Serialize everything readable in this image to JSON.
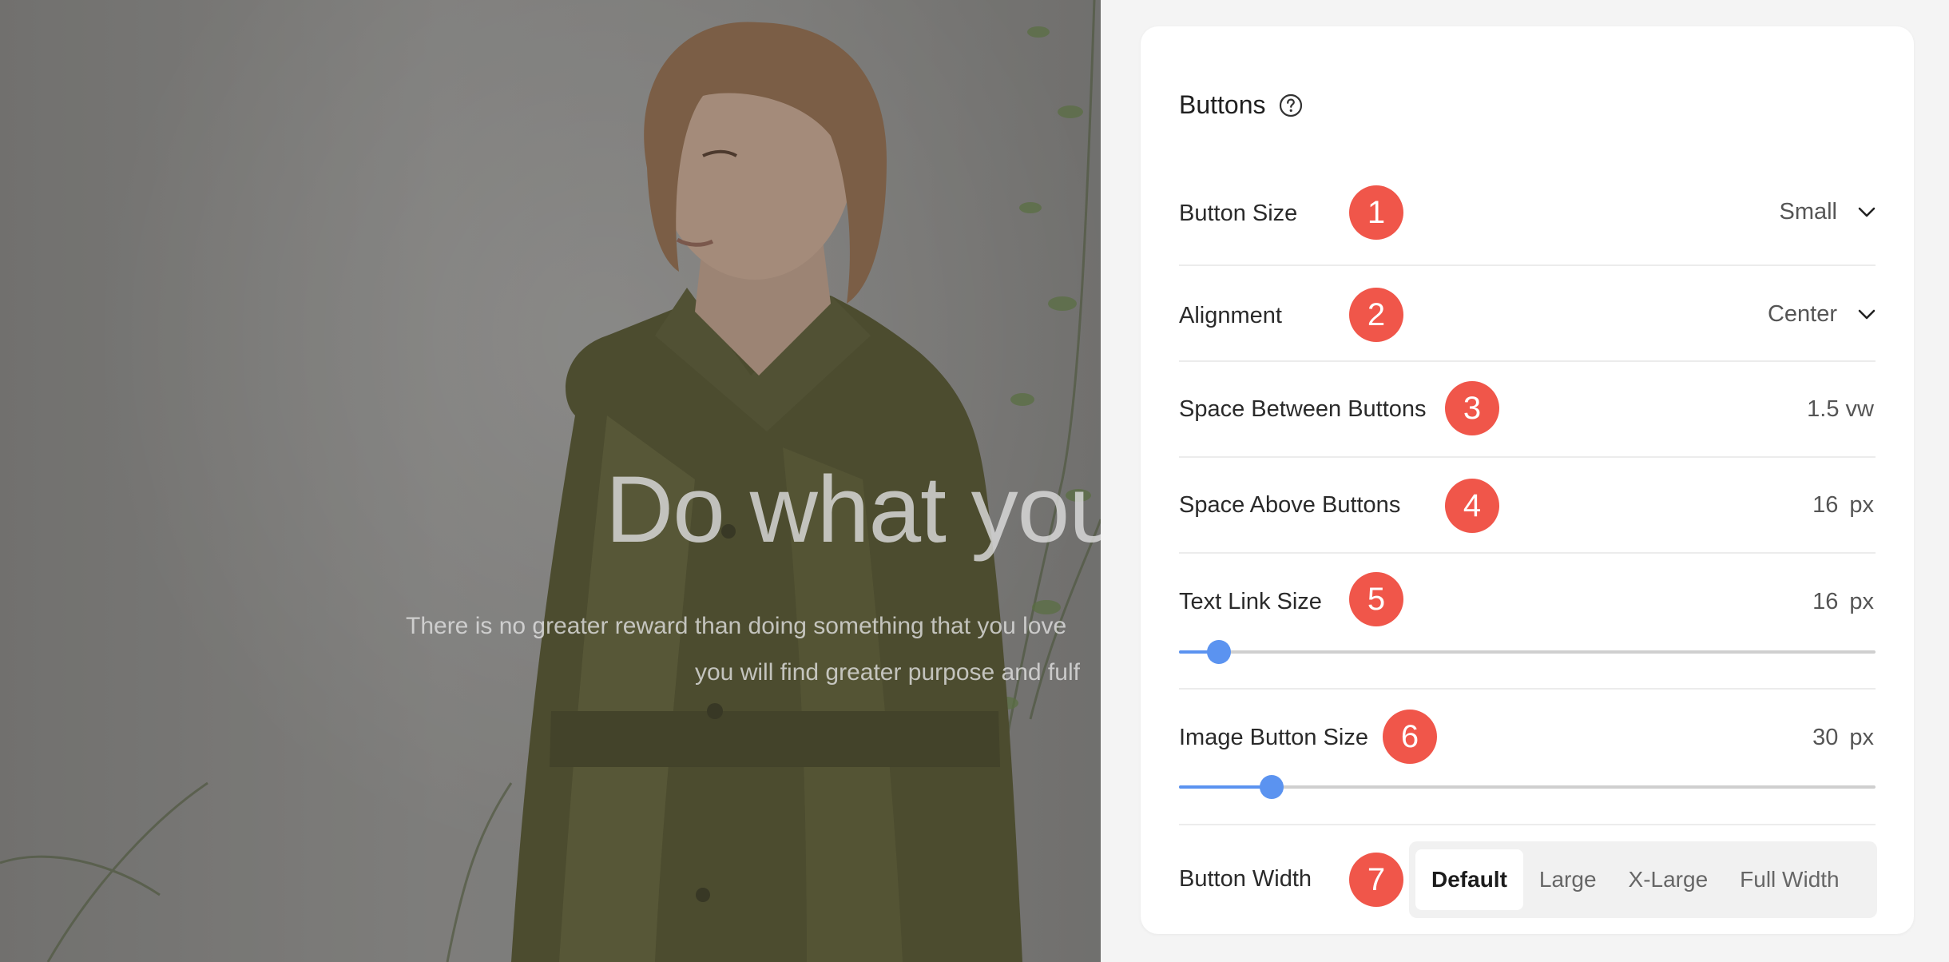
{
  "preview": {
    "headline": "Do what you",
    "subtext_line1": "There is no greater reward than doing something that you love",
    "subtext_line2": "you will find greater purpose and fulf"
  },
  "panel": {
    "title": "Buttons",
    "help_icon": "question-circle-icon",
    "rows": {
      "button_size": {
        "label": "Button Size",
        "marker": "1",
        "value": "Small"
      },
      "alignment": {
        "label": "Alignment",
        "marker": "2",
        "value": "Center"
      },
      "space_between": {
        "label": "Space Between Buttons",
        "marker": "3",
        "value": "1.5 vw"
      },
      "space_above": {
        "label": "Space Above Buttons",
        "marker": "4",
        "value": "16",
        "unit": "px"
      },
      "text_link_size": {
        "label": "Text Link Size",
        "marker": "5",
        "value": "16",
        "unit": "px",
        "slider_fraction": 0.057
      },
      "image_button_size": {
        "label": "Image Button Size",
        "marker": "6",
        "value": "30",
        "unit": "px",
        "slider_fraction": 0.133
      },
      "button_width": {
        "label": "Button Width",
        "marker": "7",
        "options": [
          "Default",
          "Large",
          "X-Large",
          "Full Width"
        ],
        "selected": "Default"
      }
    }
  },
  "colors": {
    "marker": "#f0564a",
    "slider_accent": "#5b93f0",
    "panel_bg": "#ffffff",
    "page_bg": "#f4f4f4"
  }
}
